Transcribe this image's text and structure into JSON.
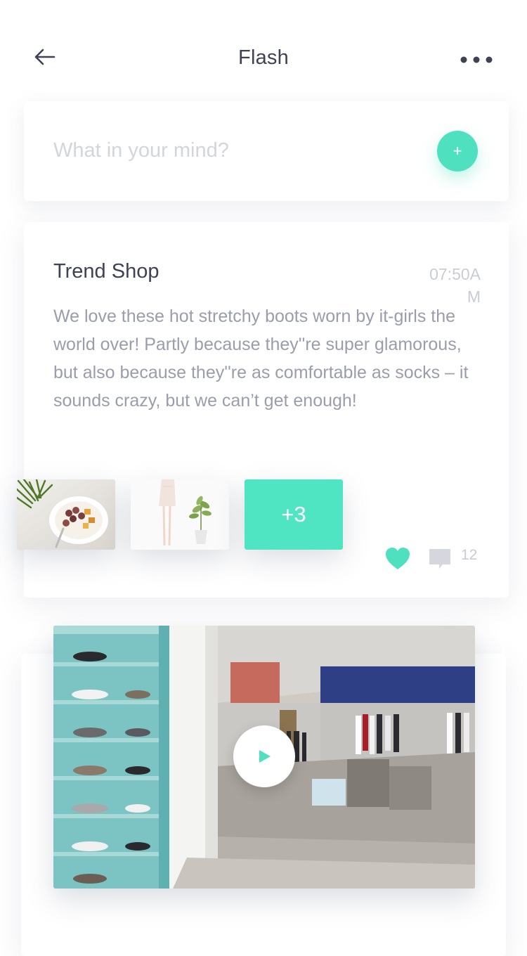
{
  "header": {
    "title": "Flash",
    "back_icon": "arrow-left-icon",
    "more_icon": "more-dots-icon"
  },
  "compose": {
    "placeholder": "What in your mind?",
    "add_label": "+"
  },
  "post": {
    "author": "Trend Shop",
    "time": "07:50AM",
    "body": "We love these hot stretchy boots worn by it-girls the world over! Partly because they''re super glamorous, but also because they''re as comfortable as socks – it sounds crazy, but we can’t get enough!",
    "images": [
      {
        "icon": "food-bowl-photo"
      },
      {
        "icon": "fashion-plant-photo"
      }
    ],
    "more_images_label": "+3",
    "liked": true,
    "comment_count": "12"
  },
  "video": {
    "thumbnail": "shoe-store-photo",
    "play_icon": "play-icon"
  },
  "colors": {
    "accent": "#4fe0bf",
    "title": "#3f4255",
    "body_text": "#9a9dab",
    "muted": "#c9ccd4",
    "placeholder": "#d3d5dc"
  }
}
